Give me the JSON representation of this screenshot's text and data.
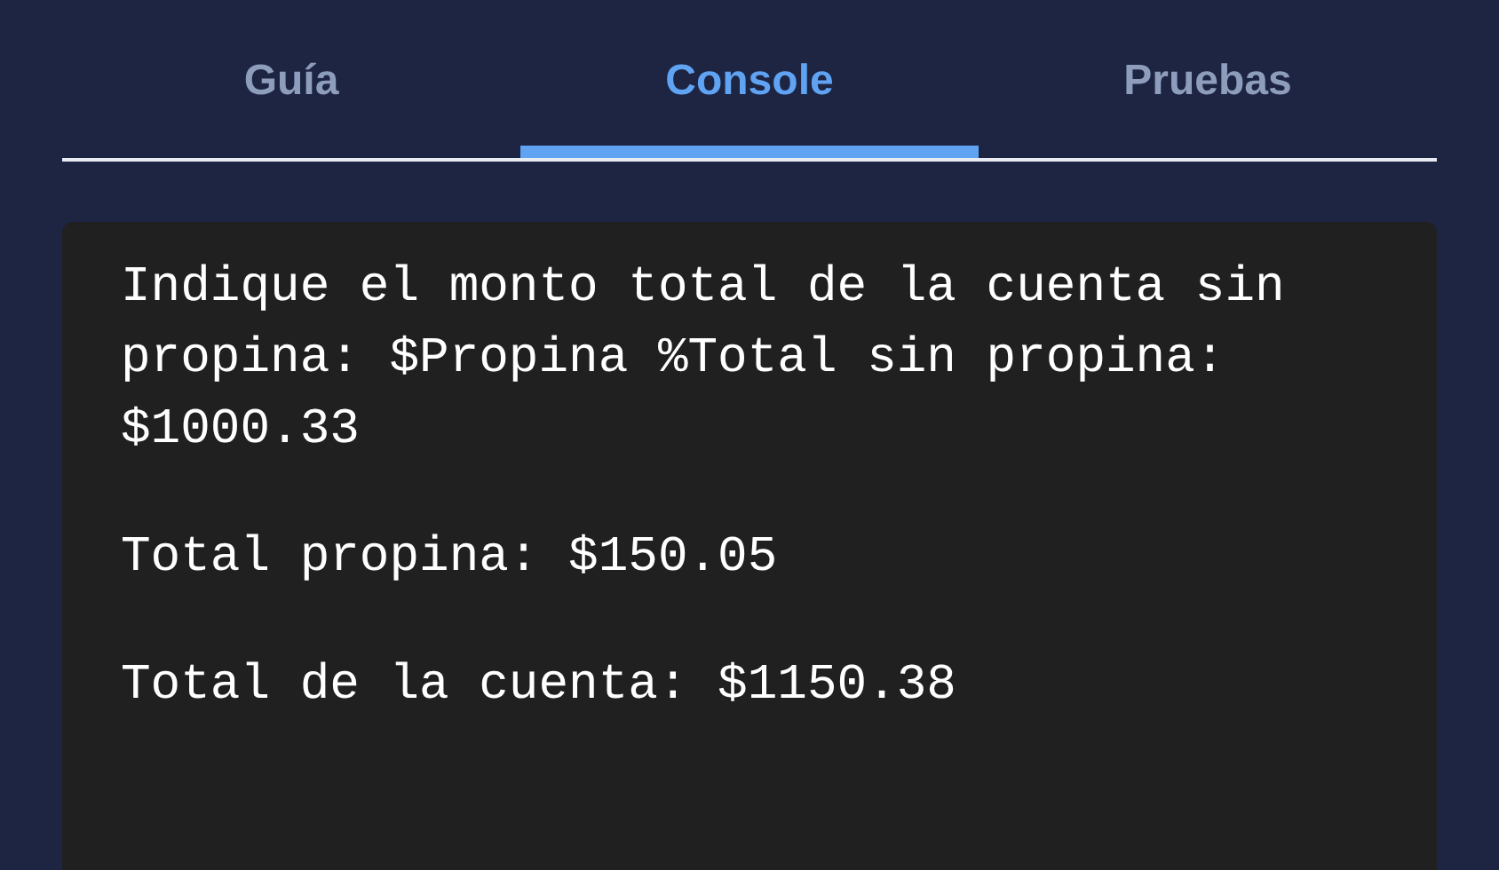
{
  "tabs": [
    {
      "label": "Guía",
      "selected": false
    },
    {
      "label": "Console",
      "selected": true
    },
    {
      "label": "Pruebas",
      "selected": false
    }
  ],
  "console": {
    "lines": [
      {
        "text": "Indique el monto total de la cuenta sin propina: $Propina %Total sin propina: $1000.33"
      },
      {
        "text": "Total propina: $150.05"
      },
      {
        "text": "Total de la cuenta: $1150.38"
      }
    ]
  }
}
